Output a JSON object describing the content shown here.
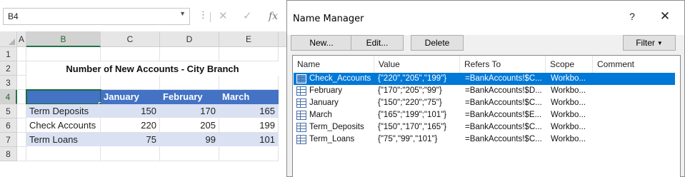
{
  "formula_bar": {
    "name_box": "B4",
    "icons": [
      "more-options-icon",
      "cancel-icon",
      "enter-icon",
      "insert-function-icon"
    ]
  },
  "sheet": {
    "columns": [
      "A",
      "B",
      "C",
      "D",
      "E"
    ],
    "rows": [
      "1",
      "2",
      "3",
      "4",
      "5",
      "6",
      "7",
      "8"
    ],
    "selected_cell": "B4",
    "title": "Number of New Accounts - City Branch",
    "table": {
      "headers": [
        "",
        "January",
        "February",
        "March"
      ],
      "rows": [
        {
          "label": "Term Deposits",
          "values": [
            "150",
            "170",
            "165"
          ]
        },
        {
          "label": "Check Accounts",
          "values": [
            "220",
            "205",
            "199"
          ]
        },
        {
          "label": "Term Loans",
          "values": [
            "75",
            "99",
            "101"
          ]
        }
      ]
    },
    "colors": {
      "header_fill": "#4472c4",
      "band_fill": "#d9e1f2",
      "selection": "#217346"
    }
  },
  "name_manager": {
    "title": "Name Manager",
    "help": "?",
    "close": "✕",
    "buttons": {
      "new": "New...",
      "edit": "Edit...",
      "delete": "Delete",
      "filter": "Filter"
    },
    "columns": [
      "Name",
      "Value",
      "Refers To",
      "Scope",
      "Comment"
    ],
    "rows": [
      {
        "name": "Check_Accounts",
        "value": "{\"220\",\"205\",\"199\"}",
        "refers_to": "=BankAccounts!$C...",
        "scope": "Workbo...",
        "comment": ""
      },
      {
        "name": "February",
        "value": "{\"170\";\"205\";\"99\"}",
        "refers_to": "=BankAccounts!$D...",
        "scope": "Workbo...",
        "comment": ""
      },
      {
        "name": "January",
        "value": "{\"150\";\"220\";\"75\"}",
        "refers_to": "=BankAccounts!$C...",
        "scope": "Workbo...",
        "comment": ""
      },
      {
        "name": "March",
        "value": "{\"165\";\"199\";\"101\"}",
        "refers_to": "=BankAccounts!$E...",
        "scope": "Workbo...",
        "comment": ""
      },
      {
        "name": "Term_Deposits",
        "value": "{\"150\",\"170\",\"165\"}",
        "refers_to": "=BankAccounts!$C...",
        "scope": "Workbo...",
        "comment": ""
      },
      {
        "name": "Term_Loans",
        "value": "{\"75\",\"99\",\"101\"}",
        "refers_to": "=BankAccounts!$C...",
        "scope": "Workbo...",
        "comment": ""
      }
    ],
    "selected_row": "Check_Accounts",
    "colors": {
      "selection": "#0078d7"
    }
  }
}
